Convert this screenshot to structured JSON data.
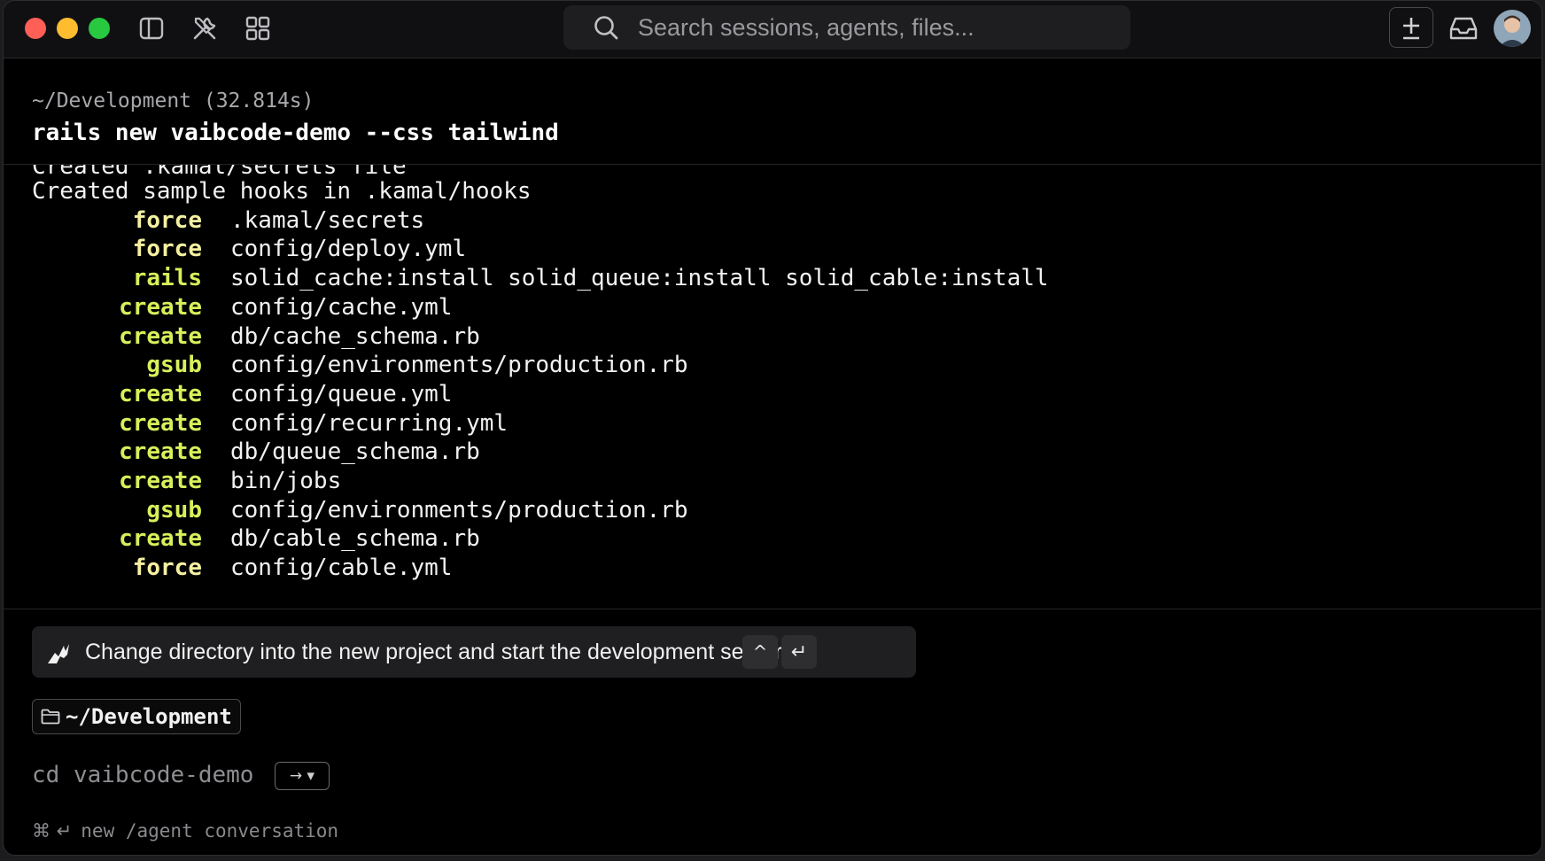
{
  "colors": {
    "close": "#ff5f57",
    "minimize": "#febc2e",
    "zoom": "#28c840",
    "action_create": "#d7f05a",
    "action_force": "#f5f0a0",
    "action_rails": "#d7f05a",
    "action_gsub": "#d7f05a"
  },
  "titlebar": {
    "search_placeholder": "Search sessions, agents, files..."
  },
  "block": {
    "meta": "~/Development (32.814s)",
    "command": "rails new vaibcode-demo --css tailwind",
    "partial_line": "Created .kamal/secrets file",
    "output": [
      {
        "text": "Created sample hooks in .kamal/hooks"
      },
      {
        "action": "force",
        "arg": ".kamal/secrets"
      },
      {
        "action": "force",
        "arg": "config/deploy.yml"
      },
      {
        "action": "rails",
        "arg": "solid_cache:install solid_queue:install solid_cable:install"
      },
      {
        "action": "create",
        "arg": "config/cache.yml"
      },
      {
        "action": "create",
        "arg": "db/cache_schema.rb"
      },
      {
        "action": "gsub",
        "arg": "config/environments/production.rb"
      },
      {
        "action": "create",
        "arg": "config/queue.yml"
      },
      {
        "action": "create",
        "arg": "config/recurring.yml"
      },
      {
        "action": "create",
        "arg": "db/queue_schema.rb"
      },
      {
        "action": "create",
        "arg": "bin/jobs"
      },
      {
        "action": "gsub",
        "arg": "config/environments/production.rb"
      },
      {
        "action": "create",
        "arg": "db/cable_schema.rb"
      },
      {
        "action": "force",
        "arg": "config/cable.yml"
      }
    ]
  },
  "suggestion": {
    "text": "Change directory into the new project and start the development server.",
    "key_up": "^",
    "key_enter": "↵"
  },
  "directory": {
    "label": "~/Development"
  },
  "input": {
    "value": "cd vaibcode-demo",
    "accept_label": "→ ▾"
  },
  "hint": {
    "shortcut": "⌘ ↵",
    "text": "new /agent conversation"
  },
  "icons": {
    "sidebar": "sidebar-toggle-icon",
    "tools": "tools-icon",
    "grid": "grid-icon",
    "search": "search-icon",
    "plus": "plus-icon",
    "inbox": "inbox-icon",
    "agent": "agent-icon",
    "folder": "folder-icon"
  }
}
